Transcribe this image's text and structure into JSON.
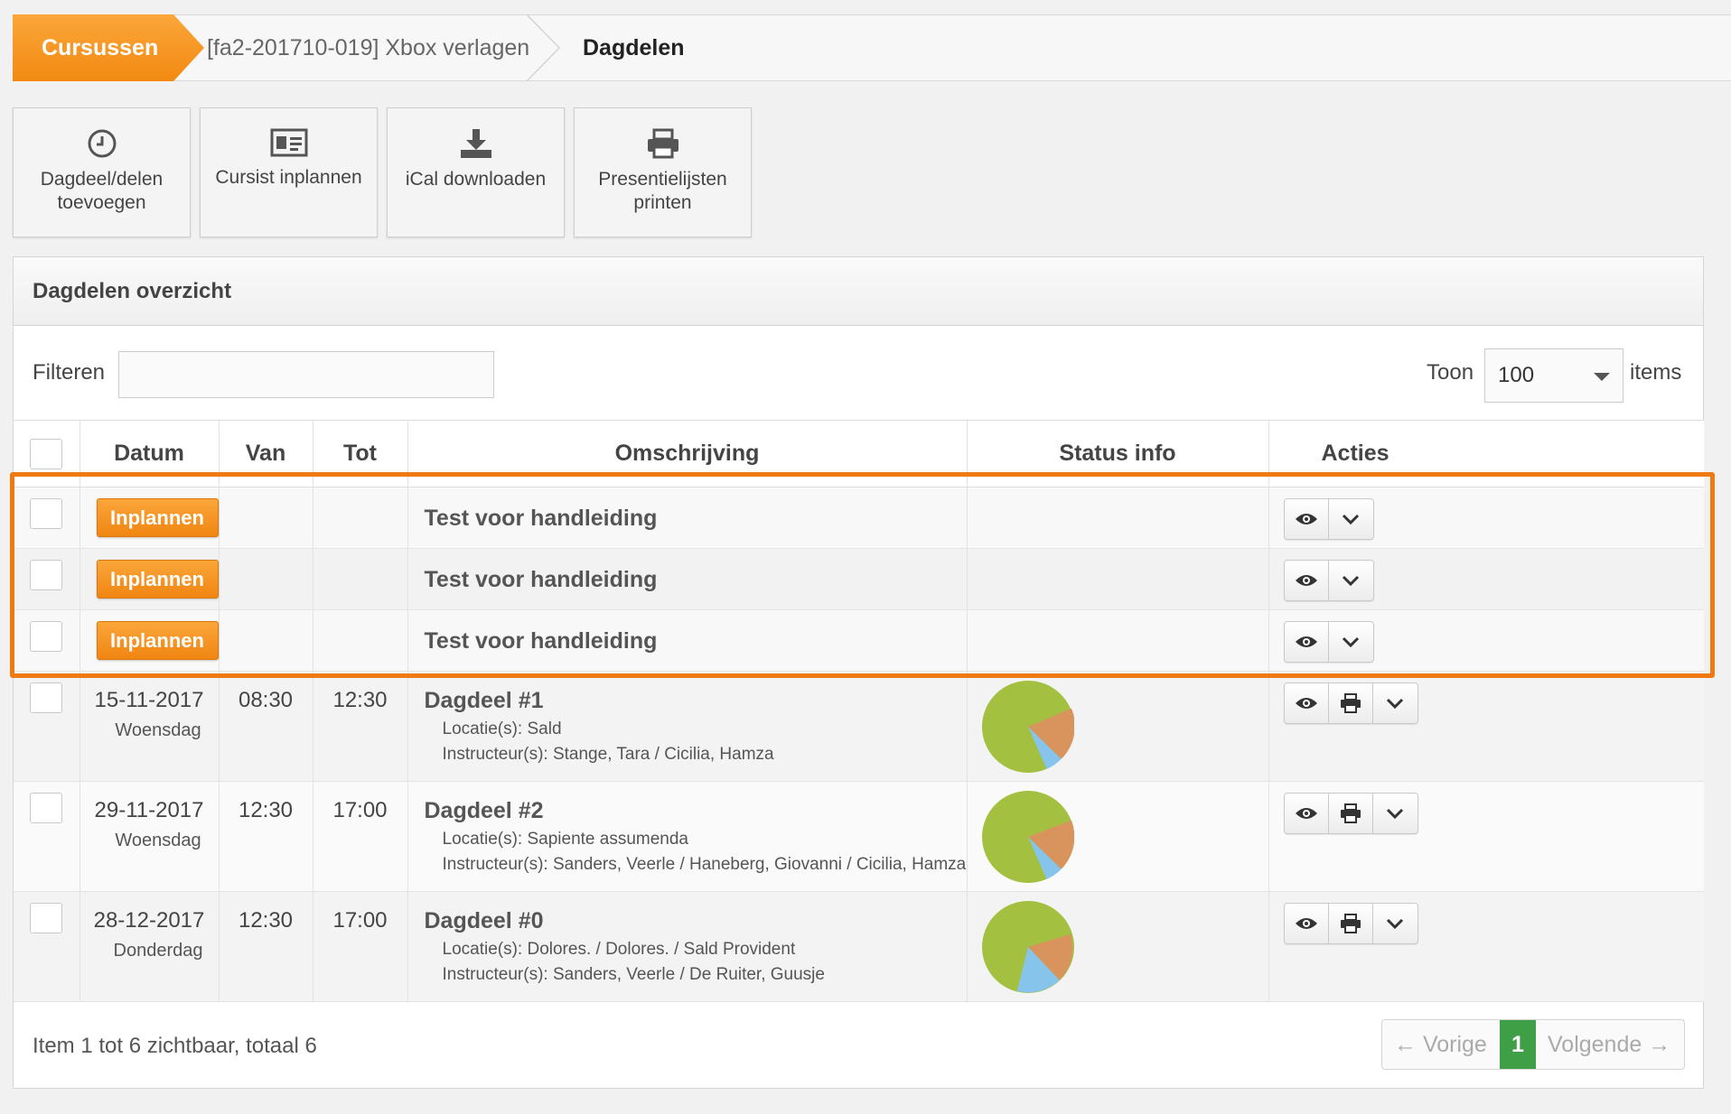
{
  "breadcrumb": {
    "home": "Cursussen",
    "course": "[fa2-201710-019] Xbox verlagen",
    "current": "Dagdelen"
  },
  "actions": [
    {
      "icon": "clock-icon",
      "label": "Dagdeel/delen toevoegen"
    },
    {
      "icon": "id-card-icon",
      "label": "Cursist inplannen"
    },
    {
      "icon": "download-icon",
      "label": "iCal downloaden"
    },
    {
      "icon": "printer-icon",
      "label": "Presentielijsten printen"
    }
  ],
  "panel": {
    "title": "Dagdelen overzicht",
    "filter_label": "Filteren",
    "filter_value": "",
    "show_label": "Toon",
    "show_value": "100",
    "items_label": "items"
  },
  "table": {
    "headers": [
      "Datum",
      "Van",
      "Tot",
      "Omschrijving",
      "Status info",
      "Acties"
    ],
    "unscheduled_rows": [
      {
        "button": "Inplannen",
        "description": "Test voor handleiding"
      },
      {
        "button": "Inplannen",
        "description": "Test voor handleiding"
      },
      {
        "button": "Inplannen",
        "description": "Test voor handleiding"
      }
    ],
    "rows": [
      {
        "date": "15-11-2017",
        "day": "Woensdag",
        "from": "08:30",
        "to": "12:30",
        "title": "Dagdeel #1",
        "location": "Locatie(s): Sald",
        "instructors": "Instructeur(s): Stange, Tara / Cicilia, Hamza"
      },
      {
        "date": "29-11-2017",
        "day": "Woensdag",
        "from": "12:30",
        "to": "17:00",
        "title": "Dagdeel #2",
        "location": "Locatie(s): Sapiente assumenda",
        "instructors": "Instructeur(s): Sanders, Veerle / Haneberg, Giovanni / Cicilia, Hamza"
      },
      {
        "date": "28-12-2017",
        "day": "Donderdag",
        "from": "12:30",
        "to": "17:00",
        "title": "Dagdeel #0",
        "location": "Locatie(s): Dolores. / Dolores. / Sald Provident",
        "instructors": "Instructeur(s): Sanders, Veerle / De Ruiter, Guusje"
      }
    ]
  },
  "footer": {
    "info": "Item 1 tot 6 zichtbaar, totaal 6",
    "prev": "← Vorige",
    "page": "1",
    "next": "Volgende →"
  },
  "colors": {
    "accent": "#f28a12",
    "highlight": "#f07a12",
    "pie_green": "#a3c040",
    "pie_orange": "#d9935c",
    "pie_blue": "#86c4ec",
    "active_page": "#3f9f47"
  }
}
